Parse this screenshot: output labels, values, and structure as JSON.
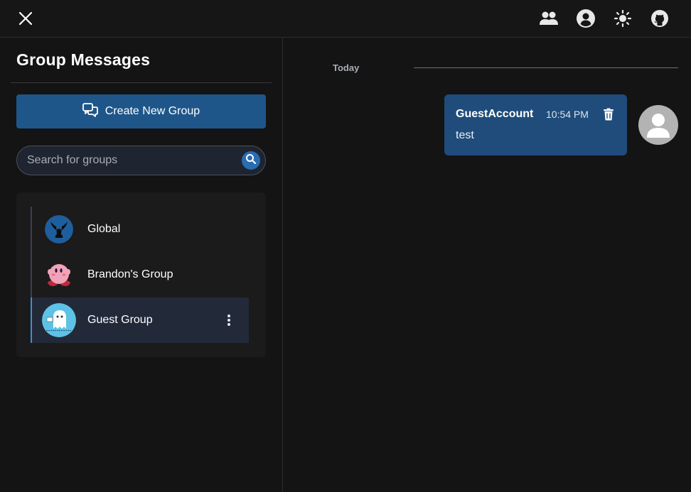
{
  "topbar": {
    "icons": [
      "close-icon",
      "group-icon",
      "account-icon",
      "theme-icon",
      "github-icon"
    ]
  },
  "sidebar": {
    "title": "Group Messages",
    "create_button_label": "Create New Group",
    "search": {
      "placeholder": "Search for groups",
      "value": ""
    },
    "groups": [
      {
        "name": "Global",
        "avatar": "global-logo",
        "active": false
      },
      {
        "name": "Brandon's Group",
        "avatar": "pink-character",
        "active": false
      },
      {
        "name": "Guest Group",
        "avatar": "ghost-seal-of-approval",
        "active": true
      }
    ]
  },
  "chat": {
    "date_label": "Today",
    "messages": [
      {
        "author": "GuestAccount",
        "time": "10:54 PM",
        "text": "test"
      }
    ]
  },
  "colors": {
    "background": "#141414",
    "accent": "#1f568a",
    "message_bubble": "#1f4c7a",
    "active_group": "#222a3a"
  }
}
